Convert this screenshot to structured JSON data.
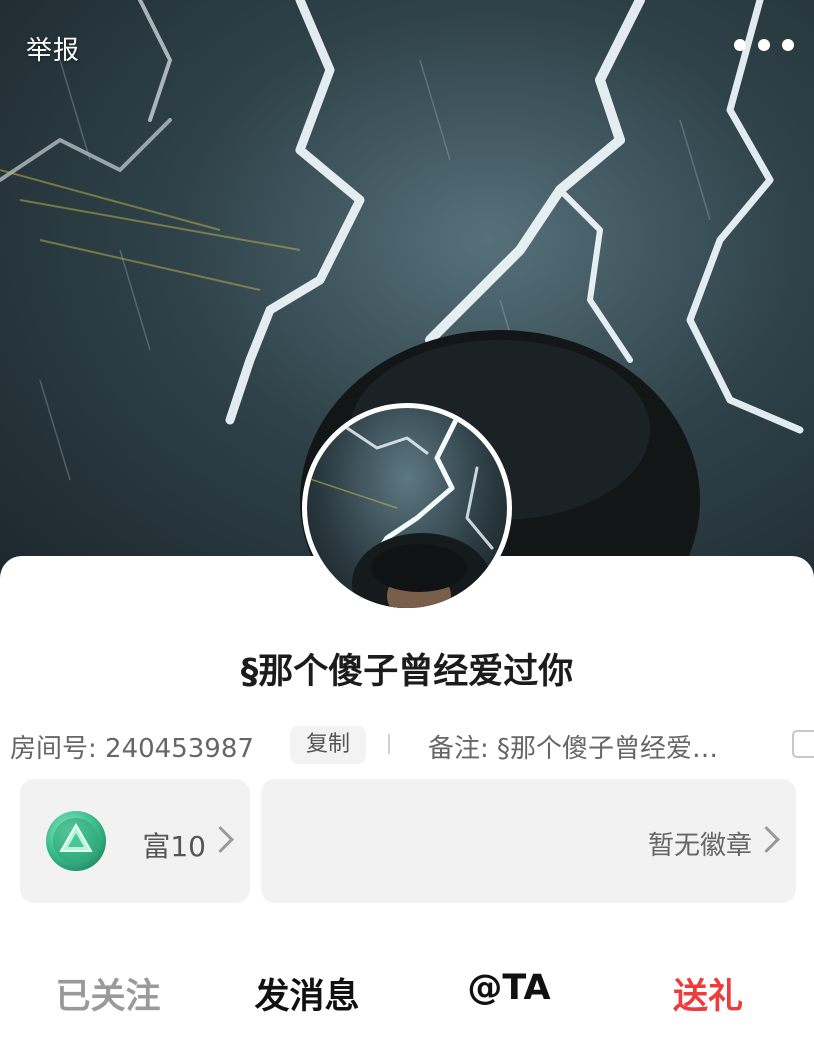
{
  "header": {
    "report_label": "举报",
    "more_icon": "more-dots-icon"
  },
  "profile": {
    "nickname": "§那个傻子曾经爱过你",
    "room_label": "房间号: 240453987",
    "copy_label": "复制",
    "note_label": "备注: §那个傻子曾经爱…",
    "edit_icon": "edit-note-icon"
  },
  "cards": {
    "rich_label": "富10",
    "rich_icon": "wealth-level-icon",
    "badge_label": "暂无徽章"
  },
  "actions": {
    "followed": "已关注",
    "message": "发消息",
    "at": "@TA",
    "gift": "送礼"
  },
  "colors": {
    "gift_red": "#ef3b3b",
    "followed_gray": "#9a9a9a",
    "card_bg": "#f2f2f2",
    "rich_green": "#3fbf8f"
  }
}
